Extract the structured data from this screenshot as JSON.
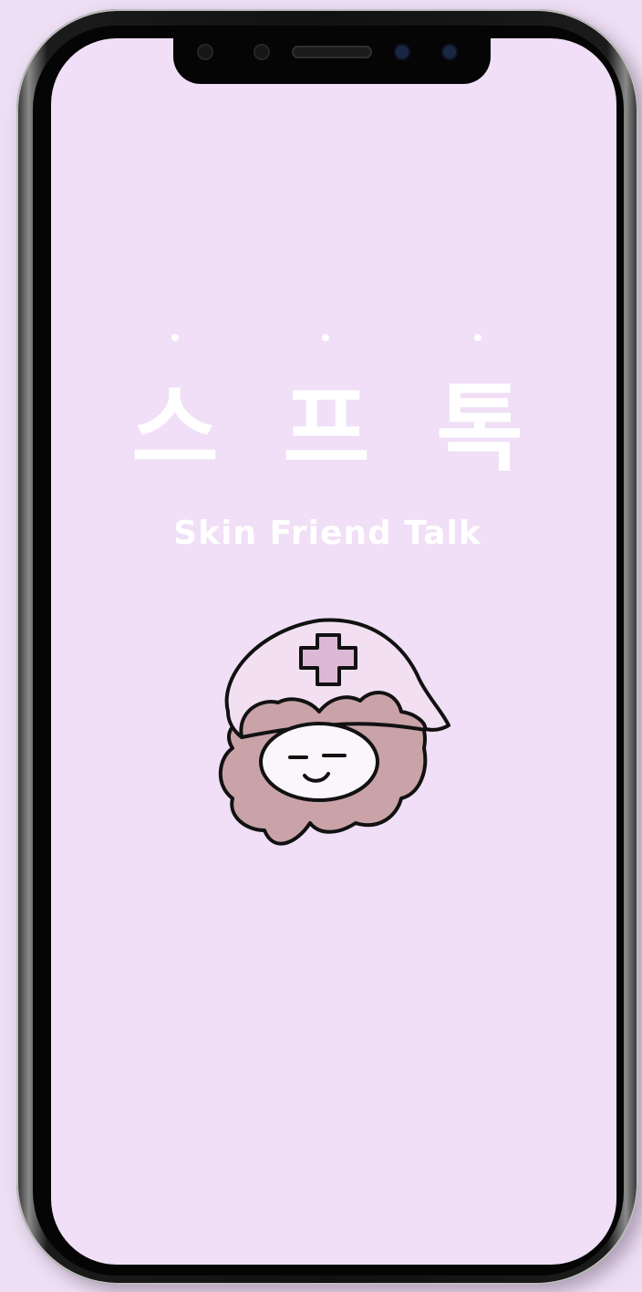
{
  "splash": {
    "title_chars": [
      "스",
      "프",
      "톡"
    ],
    "subtitle": "Skin Friend Talk"
  },
  "mascot": {
    "icon": "nurse-mascot-icon"
  },
  "colors": {
    "background": "#f0dff6",
    "text": "#ffffff",
    "mascot_body": "#c8a5a9",
    "mascot_cap": "#f2e0f2",
    "mascot_cross": "#dcb8d6"
  }
}
